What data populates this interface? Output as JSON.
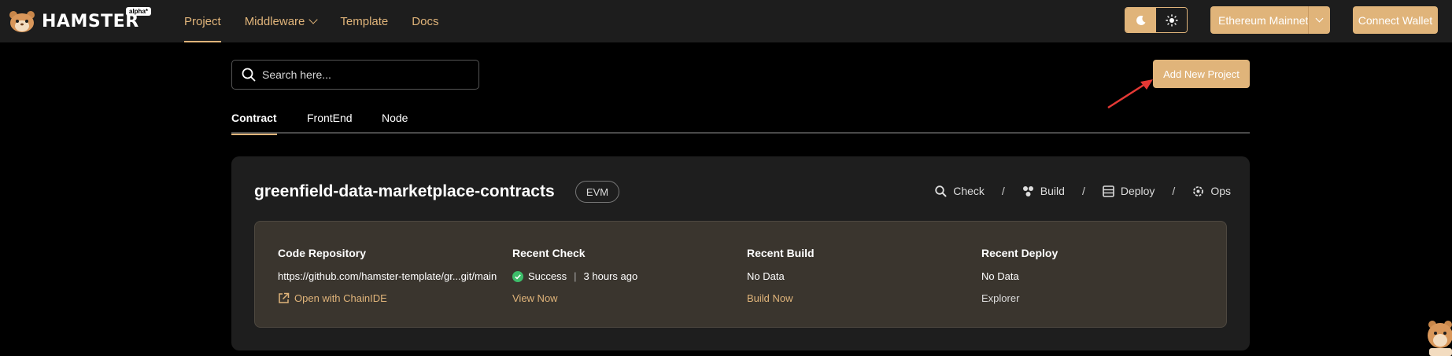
{
  "app": {
    "logo_text": "HAMSTER",
    "alpha_badge": "alpha*"
  },
  "nav": {
    "items": [
      {
        "label": "Project",
        "active": true
      },
      {
        "label": "Middleware",
        "dropdown": true
      },
      {
        "label": "Template"
      },
      {
        "label": "Docs"
      }
    ]
  },
  "header": {
    "network_label": "Ethereum Mainnet",
    "connect_label": "Connect Wallet"
  },
  "search": {
    "placeholder": "Search here..."
  },
  "add_project_label": "Add New Project",
  "tabs": [
    {
      "label": "Contract",
      "active": true
    },
    {
      "label": "FrontEnd"
    },
    {
      "label": "Node"
    }
  ],
  "project": {
    "name": "greenfield-data-marketplace-contracts",
    "badge": "EVM",
    "actions": [
      "Check",
      "Build",
      "Deploy",
      "Ops"
    ],
    "separator": "/",
    "repo": {
      "heading": "Code Repository",
      "value": "https://github.com/hamster-template/gr...git/main",
      "link": "Open with ChainIDE"
    },
    "check": {
      "heading": "Recent Check",
      "status": "Success",
      "time": "3 hours ago",
      "link": "View Now"
    },
    "build": {
      "heading": "Recent Build",
      "value": "No Data",
      "link": "Build Now"
    },
    "deploy": {
      "heading": "Recent Deploy",
      "value": "No Data",
      "link": "Explorer"
    }
  },
  "colors": {
    "accent": "#e0b47a",
    "background": "#000000",
    "topbar": "#1d1d1d",
    "card": "#1e1e1e",
    "success": "#3dbd6a",
    "annotation_arrow": "#e53935"
  }
}
